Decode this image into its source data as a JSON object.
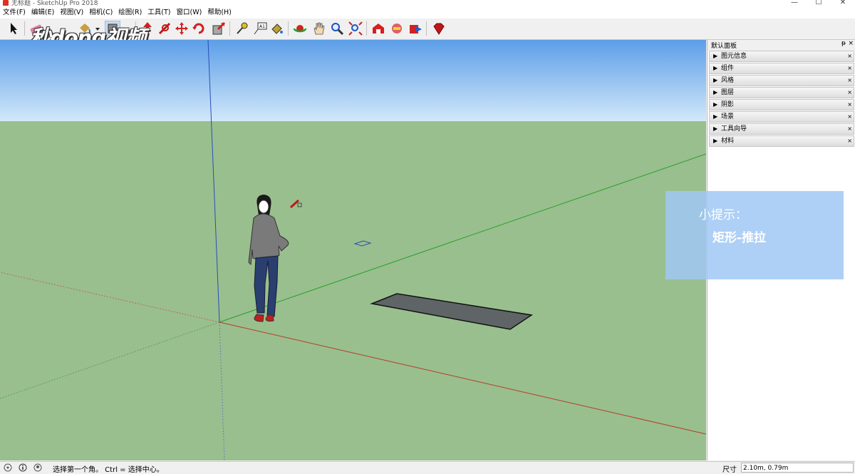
{
  "window": {
    "title": "无标题 - SketchUp Pro 2018",
    "minimize": "—",
    "maximize": "☐",
    "close": "✕"
  },
  "menu": [
    "文件(F)",
    "编辑(E)",
    "视图(V)",
    "相机(C)",
    "绘图(R)",
    "工具(T)",
    "窗口(W)",
    "帮助(H)"
  ],
  "watermark": "秒dong视频",
  "panel": {
    "title": "默认面板",
    "pin": "ᵽ",
    "close": "×",
    "items": [
      "图元信息",
      "组件",
      "风格",
      "图层",
      "阴影",
      "场景",
      "工具向导",
      "材料"
    ]
  },
  "tip": {
    "heading": "小提示：",
    "body": "矩形-推拉"
  },
  "status": {
    "text": "选择第一个角。 Ctrl = 选择中心。",
    "dim_label": "尺寸",
    "dim_value": "2.10m, 0.79m"
  },
  "colors": {
    "sky_top": "#5c9ee8",
    "ground": "#99bf8e",
    "axis_red": "#c0392b",
    "axis_green": "#2ea02e",
    "axis_blue": "#2c4fb8",
    "rect_fill": "#5f6566"
  },
  "toolbar_icons": [
    "select-icon",
    "eraser-icon",
    "paint-bucket-icon",
    "line-icon",
    "rectangle-icon",
    "push-pull-icon",
    "move-icon",
    "rotate-icon",
    "scale-icon",
    "tape-measure-icon",
    "text-icon",
    "paint-icon",
    "orbit-icon",
    "pan-icon",
    "zoom-icon",
    "zoom-extents-icon",
    "warehouse-icon",
    "extension-icon",
    "send-icon",
    "ruby-icon"
  ]
}
